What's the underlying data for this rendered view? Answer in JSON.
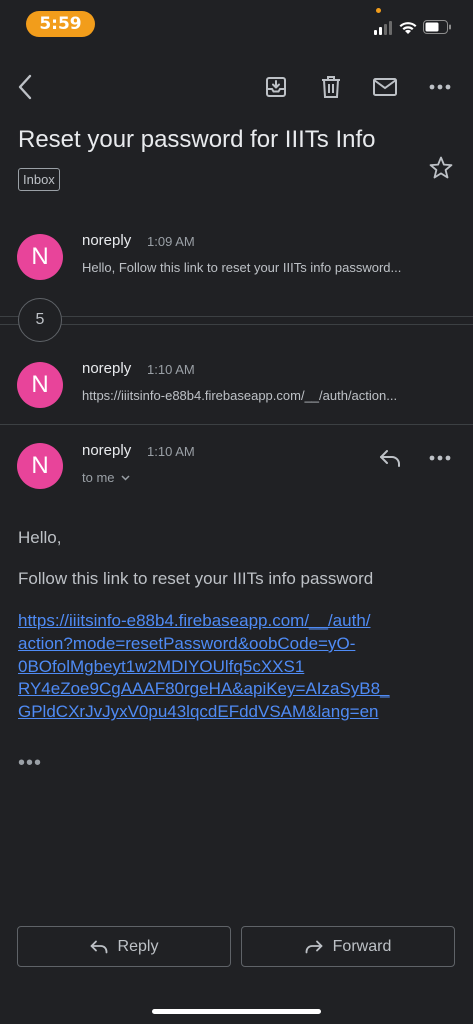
{
  "status_bar": {
    "time": "5:59"
  },
  "email": {
    "subject": "Reset your password for IIITs Info",
    "label": "Inbox",
    "collapsed_count": "5"
  },
  "thread": [
    {
      "avatar_letter": "N",
      "sender": "noreply",
      "time": "1:09 AM",
      "snippet": "Hello, Follow this link to reset your IIITs info password..."
    },
    {
      "avatar_letter": "N",
      "sender": "noreply",
      "time": "1:10 AM",
      "snippet": "https://iiitsinfo-e88b4.firebaseapp.com/__/auth/action..."
    }
  ],
  "open_message": {
    "avatar_letter": "N",
    "sender": "noreply",
    "time": "1:10 AM",
    "recipient": "to me",
    "greeting": "Hello,",
    "line": "Follow this link to reset your IIITs info password",
    "link_lines": [
      "https://iiitsinfo-e88b4.firebaseapp.com/__/auth/",
      "action?mode=resetPassword&oobCode=yO-",
      "0BOfolMgbeyt1w2MDIYOUlfq5cXXS1",
      "RY4eZoe9CgAAAF80rgeHA&apiKey=AIzaSyB8_",
      "GPldCXrJvJyxV0pu43lqcdEFddVSAM&lang=en"
    ],
    "more": "•••"
  },
  "actions": {
    "reply_label": "Reply",
    "forward_label": "Forward"
  },
  "colors": {
    "avatar": "#e8449a",
    "link": "#4f8bf5",
    "time_pill": "#f29d1b",
    "background": "#202124"
  }
}
